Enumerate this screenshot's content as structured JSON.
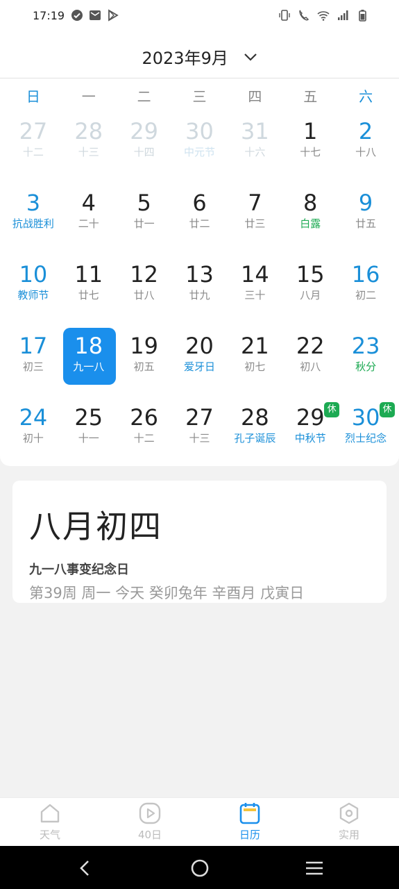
{
  "status_bar": {
    "time": "17:19"
  },
  "header": {
    "title": "2023年9月"
  },
  "weekdays": [
    "日",
    "一",
    "二",
    "三",
    "四",
    "五",
    "六"
  ],
  "calendar": {
    "weeks": [
      [
        {
          "day": "27",
          "lunar": "十二",
          "type": "other"
        },
        {
          "day": "28",
          "lunar": "十三",
          "type": "other"
        },
        {
          "day": "29",
          "lunar": "十四",
          "type": "other"
        },
        {
          "day": "30",
          "lunar": "中元节",
          "type": "other",
          "holiday": true
        },
        {
          "day": "31",
          "lunar": "十六",
          "type": "other"
        },
        {
          "day": "1",
          "lunar": "十七"
        },
        {
          "day": "2",
          "lunar": "十八"
        }
      ],
      [
        {
          "day": "3",
          "lunar": "抗战胜利",
          "lunar_style": "festival"
        },
        {
          "day": "4",
          "lunar": "二十"
        },
        {
          "day": "5",
          "lunar": "廿一"
        },
        {
          "day": "6",
          "lunar": "廿二"
        },
        {
          "day": "7",
          "lunar": "廿三"
        },
        {
          "day": "8",
          "lunar": "白露",
          "lunar_style": "solar-term"
        },
        {
          "day": "9",
          "lunar": "廿五"
        }
      ],
      [
        {
          "day": "10",
          "lunar": "教师节",
          "lunar_style": "festival"
        },
        {
          "day": "11",
          "lunar": "廿七"
        },
        {
          "day": "12",
          "lunar": "廿八"
        },
        {
          "day": "13",
          "lunar": "廿九"
        },
        {
          "day": "14",
          "lunar": "三十"
        },
        {
          "day": "15",
          "lunar": "八月"
        },
        {
          "day": "16",
          "lunar": "初二"
        }
      ],
      [
        {
          "day": "17",
          "lunar": "初三"
        },
        {
          "day": "18",
          "lunar": "九一八",
          "selected": true
        },
        {
          "day": "19",
          "lunar": "初五"
        },
        {
          "day": "20",
          "lunar": "爱牙日",
          "lunar_style": "festival"
        },
        {
          "day": "21",
          "lunar": "初七"
        },
        {
          "day": "22",
          "lunar": "初八"
        },
        {
          "day": "23",
          "lunar": "秋分",
          "lunar_style": "solar-term"
        }
      ],
      [
        {
          "day": "24",
          "lunar": "初十"
        },
        {
          "day": "25",
          "lunar": "十一"
        },
        {
          "day": "26",
          "lunar": "十二"
        },
        {
          "day": "27",
          "lunar": "十三"
        },
        {
          "day": "28",
          "lunar": "孔子诞辰",
          "lunar_style": "festival"
        },
        {
          "day": "29",
          "lunar": "中秋节",
          "lunar_style": "festival",
          "badge": "休"
        },
        {
          "day": "30",
          "lunar": "烈士纪念",
          "lunar_style": "festival",
          "badge": "休"
        }
      ]
    ]
  },
  "info": {
    "lunar_date": "八月初四",
    "event": "九一八事变纪念日",
    "details": "第39周 周一 今天 癸卯兔年 辛酉月 戊寅日"
  },
  "bottom_nav": {
    "items": [
      {
        "label": "天气",
        "icon": "house-icon"
      },
      {
        "label": "40日",
        "icon": "play-icon"
      },
      {
        "label": "日历",
        "icon": "calendar-icon",
        "active": true
      },
      {
        "label": "实用",
        "icon": "hexagon-icon"
      }
    ]
  },
  "colors": {
    "accent": "#1a8fec",
    "weekend": "#1a8fd8",
    "solar_term": "#1daa53",
    "badge": "#1daa53"
  }
}
